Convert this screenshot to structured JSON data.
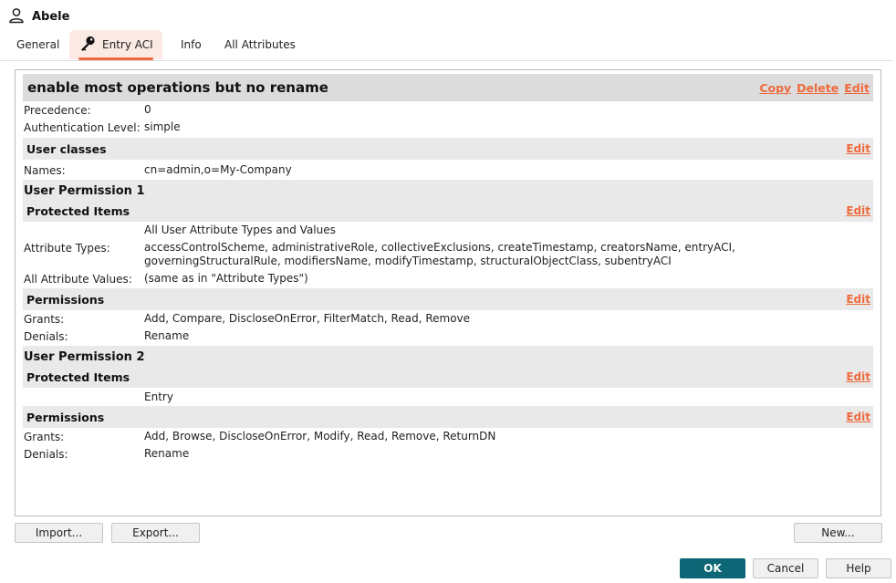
{
  "window": {
    "title": "Abele",
    "icon": "user-icon"
  },
  "tabs": [
    {
      "label": "General"
    },
    {
      "label": "Entry ACI",
      "icon": "key-icon",
      "active": true
    },
    {
      "label": "Info"
    },
    {
      "label": "All Attributes"
    }
  ],
  "aci": {
    "name": "enable most operations but no rename",
    "actions": {
      "copy": "Copy",
      "delete": "Delete",
      "edit": "Edit"
    },
    "precedence_label": "Precedence:",
    "precedence": "0",
    "auth_label": "Authentication Level:",
    "auth": "simple",
    "user_classes": {
      "title": "User classes",
      "edit": "Edit",
      "names_label": "Names:",
      "names": "cn=admin,o=My-Company"
    },
    "perm1": {
      "title": "User Permission 1",
      "protected": {
        "title": "Protected Items",
        "edit": "Edit",
        "all_user_attr": "All User Attribute Types and Values",
        "attr_types_label": "Attribute Types:",
        "attr_types_line1": "accessControlScheme, administrativeRole, collectiveExclusions, createTimestamp, creatorsName, entryACI,",
        "attr_types_line2": "governingStructuralRule, modifiersName, modifyTimestamp, structuralObjectClass, subentryACI",
        "all_values_label": "All Attribute Values:",
        "all_values": "(same as in \"Attribute Types\")"
      },
      "permissions": {
        "title": "Permissions",
        "edit": "Edit",
        "grants_label": "Grants:",
        "grants": "Add, Compare, DiscloseOnError, FilterMatch, Read, Remove",
        "denials_label": "Denials:",
        "denials": "Rename"
      }
    },
    "perm2": {
      "title": "User Permission 2",
      "protected": {
        "title": "Protected Items",
        "edit": "Edit",
        "entry": "Entry"
      },
      "permissions": {
        "title": "Permissions",
        "edit": "Edit",
        "grants_label": "Grants:",
        "grants": "Add, Browse, DiscloseOnError, Modify, Read, Remove, ReturnDN",
        "denials_label": "Denials:",
        "denials": "Rename"
      }
    }
  },
  "buttons": {
    "import": "Import...",
    "export": "Export...",
    "new": "New...",
    "ok": "OK",
    "cancel": "Cancel",
    "help": "Help"
  },
  "colors": {
    "accent": "#ee6a3d",
    "primary": "#0c6676",
    "tab_active_bg": "#fbe9e3"
  }
}
